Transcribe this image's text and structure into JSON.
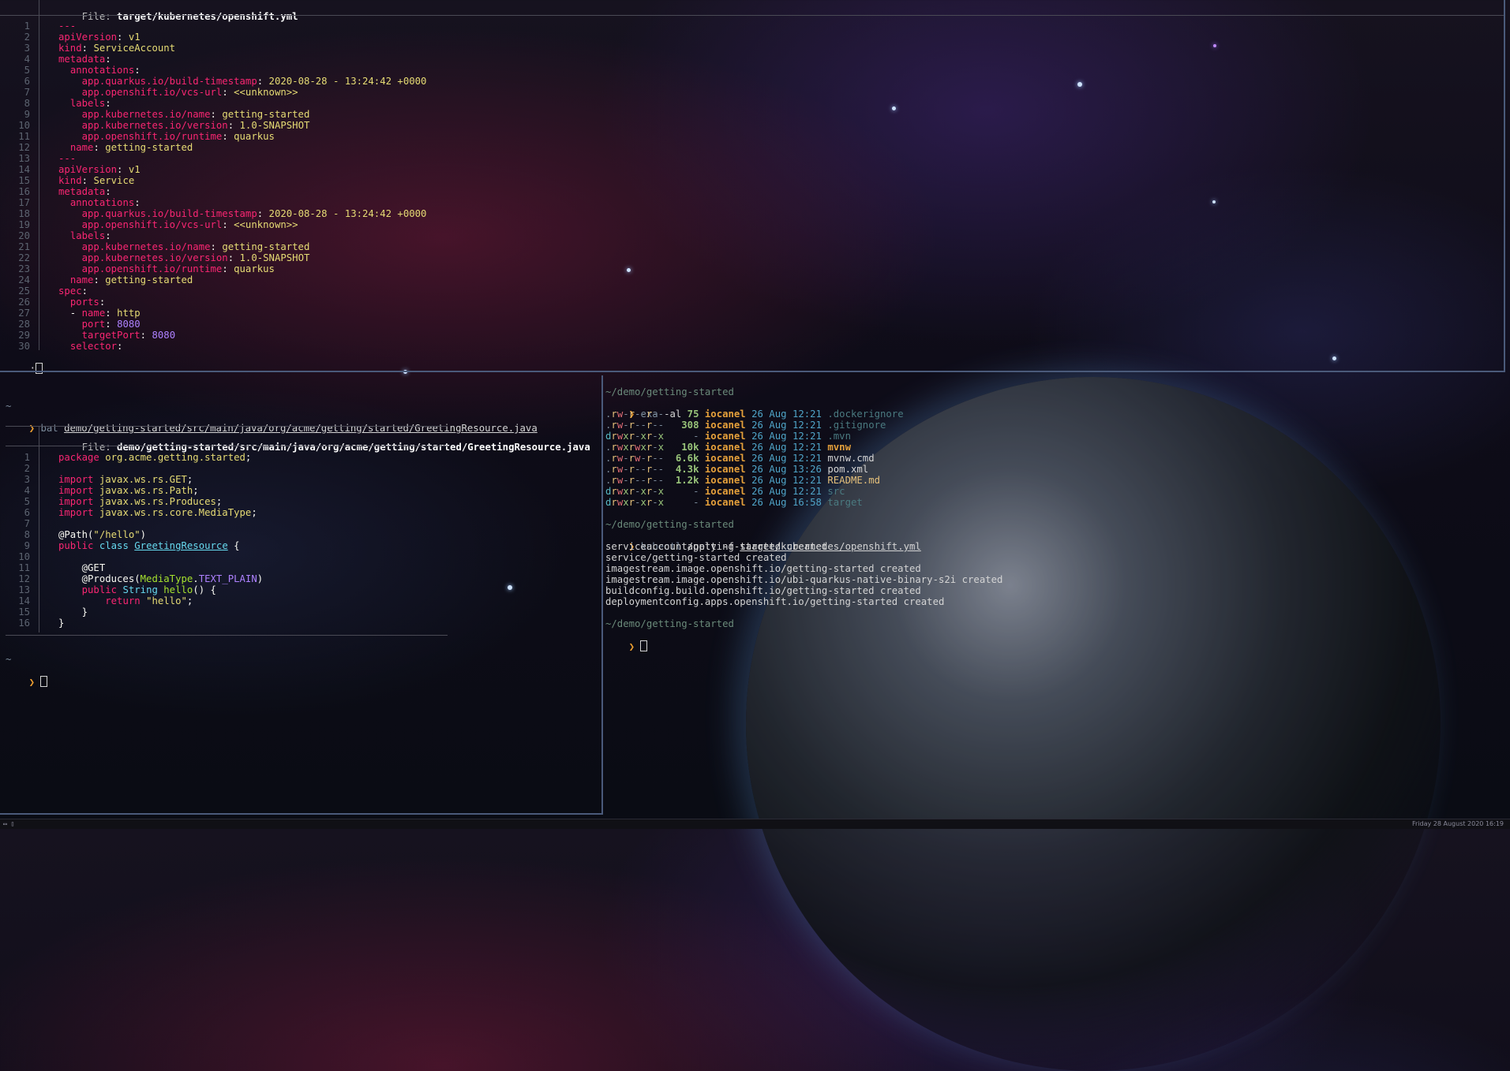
{
  "top_pane": {
    "header_label": "File: ",
    "header_file": "target/kubernetes/openshift.yml",
    "status_prompt": ":",
    "lines": [
      [
        [
          "k",
          "---"
        ]
      ],
      [
        [
          "k",
          "apiVersion"
        ],
        [
          "w",
          ": "
        ],
        [
          "v",
          "v1"
        ]
      ],
      [
        [
          "k",
          "kind"
        ],
        [
          "w",
          ": "
        ],
        [
          "v",
          "ServiceAccount"
        ]
      ],
      [
        [
          "k",
          "metadata"
        ],
        [
          "w",
          ":"
        ]
      ],
      [
        [
          "w",
          "  "
        ],
        [
          "k",
          "annotations"
        ],
        [
          "w",
          ":"
        ]
      ],
      [
        [
          "w",
          "    "
        ],
        [
          "k",
          "app.quarkus.io/build-timestamp"
        ],
        [
          "w",
          ": "
        ],
        [
          "v",
          "2020-08-28 - 13:24:42 +0000"
        ]
      ],
      [
        [
          "w",
          "    "
        ],
        [
          "k",
          "app.openshift.io/vcs-url"
        ],
        [
          "w",
          ": "
        ],
        [
          "v",
          "<<unknown>>"
        ]
      ],
      [
        [
          "w",
          "  "
        ],
        [
          "k",
          "labels"
        ],
        [
          "w",
          ":"
        ]
      ],
      [
        [
          "w",
          "    "
        ],
        [
          "k",
          "app.kubernetes.io/name"
        ],
        [
          "w",
          ": "
        ],
        [
          "v",
          "getting-started"
        ]
      ],
      [
        [
          "w",
          "    "
        ],
        [
          "k",
          "app.kubernetes.io/version"
        ],
        [
          "w",
          ": "
        ],
        [
          "v",
          "1.0-SNAPSHOT"
        ]
      ],
      [
        [
          "w",
          "    "
        ],
        [
          "k",
          "app.openshift.io/runtime"
        ],
        [
          "w",
          ": "
        ],
        [
          "v",
          "quarkus"
        ]
      ],
      [
        [
          "w",
          "  "
        ],
        [
          "k",
          "name"
        ],
        [
          "w",
          ": "
        ],
        [
          "v",
          "getting-started"
        ]
      ],
      [
        [
          "k",
          "---"
        ]
      ],
      [
        [
          "k",
          "apiVersion"
        ],
        [
          "w",
          ": "
        ],
        [
          "v",
          "v1"
        ]
      ],
      [
        [
          "k",
          "kind"
        ],
        [
          "w",
          ": "
        ],
        [
          "v",
          "Service"
        ]
      ],
      [
        [
          "k",
          "metadata"
        ],
        [
          "w",
          ":"
        ]
      ],
      [
        [
          "w",
          "  "
        ],
        [
          "k",
          "annotations"
        ],
        [
          "w",
          ":"
        ]
      ],
      [
        [
          "w",
          "    "
        ],
        [
          "k",
          "app.quarkus.io/build-timestamp"
        ],
        [
          "w",
          ": "
        ],
        [
          "v",
          "2020-08-28 - 13:24:42 +0000"
        ]
      ],
      [
        [
          "w",
          "    "
        ],
        [
          "k",
          "app.openshift.io/vcs-url"
        ],
        [
          "w",
          ": "
        ],
        [
          "v",
          "<<unknown>>"
        ]
      ],
      [
        [
          "w",
          "  "
        ],
        [
          "k",
          "labels"
        ],
        [
          "w",
          ":"
        ]
      ],
      [
        [
          "w",
          "    "
        ],
        [
          "k",
          "app.kubernetes.io/name"
        ],
        [
          "w",
          ": "
        ],
        [
          "v",
          "getting-started"
        ]
      ],
      [
        [
          "w",
          "    "
        ],
        [
          "k",
          "app.kubernetes.io/version"
        ],
        [
          "w",
          ": "
        ],
        [
          "v",
          "1.0-SNAPSHOT"
        ]
      ],
      [
        [
          "w",
          "    "
        ],
        [
          "k",
          "app.openshift.io/runtime"
        ],
        [
          "w",
          ": "
        ],
        [
          "v",
          "quarkus"
        ]
      ],
      [
        [
          "w",
          "  "
        ],
        [
          "k",
          "name"
        ],
        [
          "w",
          ": "
        ],
        [
          "v",
          "getting-started"
        ]
      ],
      [
        [
          "k",
          "spec"
        ],
        [
          "w",
          ":"
        ]
      ],
      [
        [
          "w",
          "  "
        ],
        [
          "k",
          "ports"
        ],
        [
          "w",
          ":"
        ]
      ],
      [
        [
          "w",
          "  - "
        ],
        [
          "k",
          "name"
        ],
        [
          "w",
          ": "
        ],
        [
          "v",
          "http"
        ]
      ],
      [
        [
          "w",
          "    "
        ],
        [
          "k",
          "port"
        ],
        [
          "w",
          ": "
        ],
        [
          "n",
          "8080"
        ]
      ],
      [
        [
          "w",
          "    "
        ],
        [
          "k",
          "targetPort"
        ],
        [
          "w",
          ": "
        ],
        [
          "n",
          "8080"
        ]
      ],
      [
        [
          "w",
          "  "
        ],
        [
          "k",
          "selector"
        ],
        [
          "w",
          ":"
        ]
      ]
    ]
  },
  "left_pane": {
    "tilde": "~",
    "prompt_symbol": "❯",
    "command": "bat",
    "command_arg": "demo/getting-started/src/main/java/org/acme/getting/started/GreetingResource.java",
    "header_label": "File: ",
    "header_file": "demo/getting-started/src/main/java/org/acme/getting/started/GreetingResource.java",
    "lines": [
      [
        [
          "k",
          "package"
        ],
        [
          "w",
          " "
        ],
        [
          "v",
          "org.acme.getting.started"
        ],
        [
          "w",
          ";"
        ]
      ],
      [],
      [
        [
          "k",
          "import"
        ],
        [
          "w",
          " "
        ],
        [
          "v",
          "javax.ws.rs.GET"
        ],
        [
          "w",
          ";"
        ]
      ],
      [
        [
          "k",
          "import"
        ],
        [
          "w",
          " "
        ],
        [
          "v",
          "javax.ws.rs.Path"
        ],
        [
          "w",
          ";"
        ]
      ],
      [
        [
          "k",
          "import"
        ],
        [
          "w",
          " "
        ],
        [
          "v",
          "javax.ws.rs.Produces"
        ],
        [
          "w",
          ";"
        ]
      ],
      [
        [
          "k",
          "import"
        ],
        [
          "w",
          " "
        ],
        [
          "v",
          "javax.ws.rs.core.MediaType"
        ],
        [
          "w",
          ";"
        ]
      ],
      [],
      [
        [
          "w",
          "@Path("
        ],
        [
          "v",
          "\"/hello\""
        ],
        [
          "w",
          ")"
        ]
      ],
      [
        [
          "k",
          "public"
        ],
        [
          "w",
          " "
        ],
        [
          "cyan",
          "class"
        ],
        [
          "w",
          " "
        ],
        [
          "cls",
          "GreetingResource"
        ],
        [
          "w",
          " {"
        ]
      ],
      [],
      [
        [
          "w",
          "    @GET"
        ]
      ],
      [
        [
          "w",
          "    @Produces("
        ],
        [
          "grn",
          "MediaType"
        ],
        [
          "w",
          "."
        ],
        [
          "n",
          "TEXT_PLAIN"
        ],
        [
          "w",
          ")"
        ]
      ],
      [
        [
          "w",
          "    "
        ],
        [
          "k",
          "public"
        ],
        [
          "w",
          " "
        ],
        [
          "cyan",
          "String"
        ],
        [
          "w",
          " "
        ],
        [
          "grn",
          "hello"
        ],
        [
          "w",
          "() {"
        ]
      ],
      [
        [
          "w",
          "        "
        ],
        [
          "k",
          "return"
        ],
        [
          "w",
          " "
        ],
        [
          "v",
          "\"hello\""
        ],
        [
          "w",
          ";"
        ]
      ],
      [
        [
          "w",
          "    }"
        ]
      ],
      [
        [
          "w",
          "}"
        ]
      ]
    ],
    "final_tilde": "~",
    "final_prompt": "❯"
  },
  "right_pane": {
    "cwd": "~/demo/getting-started",
    "prompt_symbol": "❯",
    "cmd1": "exa",
    "cmd1_args": "-al",
    "listing": [
      {
        "perms": ".rw-r--r--",
        "size": "75",
        "user": "iocanel",
        "date": "26 Aug 12:21",
        "name": ".dockerignore",
        "kind": "hidden"
      },
      {
        "perms": ".rw-r--r--",
        "size": "308",
        "user": "iocanel",
        "date": "26 Aug 12:21",
        "name": ".gitignore",
        "kind": "hidden"
      },
      {
        "perms": "drwxr-xr-x",
        "size": "-",
        "user": "iocanel",
        "date": "26 Aug 12:21",
        "name": ".mvn",
        "kind": "hidden"
      },
      {
        "perms": ".rwxrwxr-x",
        "size": "10k",
        "user": "iocanel",
        "date": "26 Aug 12:21",
        "name": "mvnw",
        "kind": "exec"
      },
      {
        "perms": ".rw-rw-r--",
        "size": "6.6k",
        "user": "iocanel",
        "date": "26 Aug 12:21",
        "name": "mvnw.cmd",
        "kind": "plain"
      },
      {
        "perms": ".rw-r--r--",
        "size": "4.3k",
        "user": "iocanel",
        "date": "26 Aug 13:26",
        "name": "pom.xml",
        "kind": "plain"
      },
      {
        "perms": ".rw-r--r--",
        "size": "1.2k",
        "user": "iocanel",
        "date": "26 Aug 12:21",
        "name": "README.md",
        "kind": "yellow"
      },
      {
        "perms": "drwxr-xr-x",
        "size": "-",
        "user": "iocanel",
        "date": "26 Aug 12:21",
        "name": "src",
        "kind": "hidden"
      },
      {
        "perms": "drwxr-xr-x",
        "size": "-",
        "user": "iocanel",
        "date": "26 Aug 16:58",
        "name": "target",
        "kind": "hidden"
      }
    ],
    "cwd2": "~/demo/getting-started",
    "cmd2": "kubectl",
    "cmd2_mid": " apply -f ",
    "cmd2_arg": "target/kubernetes/openshift.yml",
    "output": [
      "serviceaccount/getting-started created",
      "service/getting-started created",
      "imagestream.image.openshift.io/getting-started created",
      "imagestream.image.openshift.io/ubi-quarkus-native-binary-s2i created",
      "buildconfig.build.openshift.io/getting-started created",
      "deploymentconfig.apps.openshift.io/getting-started created"
    ],
    "cwd3": "~/demo/getting-started"
  },
  "statusbar": {
    "workspace_indicator": "▭ ▯",
    "clock": "Friday 28 August 2020 16:19"
  },
  "colors": {
    "border": "#4a5a7a",
    "keyword": "#f92672",
    "string": "#e6db74",
    "number": "#ae81ff",
    "prompt": "#f0a030"
  }
}
